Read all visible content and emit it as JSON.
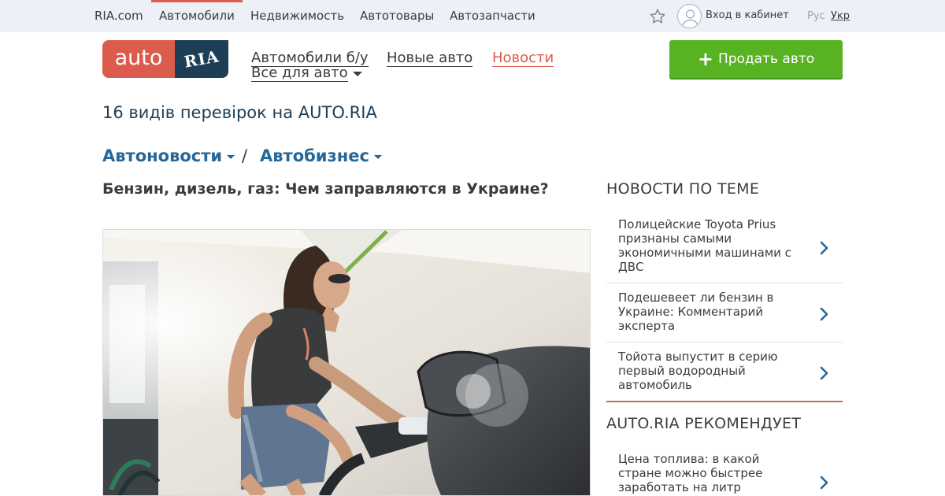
{
  "topbar": {
    "links": [
      "RIA.com",
      "Автомобили",
      "Недвижимость",
      "Автотовары",
      "Автозапчасти"
    ],
    "active": "Автомобили",
    "login_label": "Вход в кабинет",
    "lang_ru": "Рус",
    "lang_ua": "Укр"
  },
  "logo": {
    "auto": "auto",
    "ria": "RIA"
  },
  "header_nav": {
    "used_cars": "Автомобили б/у",
    "new_cars": "Новые авто",
    "news": "Новости",
    "all_for_car": "Все для авто"
  },
  "sell_button": "Продать авто",
  "promo": "16 видів перевірок на AUTO.RIA",
  "breadcrumb": {
    "item1": "Автоновости",
    "separator": "/",
    "item2": "Автобизнес"
  },
  "article": {
    "title": "Бензин, дизель, газ: Чем заправляются в Украине?"
  },
  "sidebar": {
    "related_title": "НОВОСТИ ПО ТЕМЕ",
    "related": [
      "Полицейские Toyota Prius признаны самыми экономичными машинами с ДВС",
      "Подешевеет ли бензин в Украине: Комментарий эксперта",
      "Тойота выпустит в серию первый водородный автомобиль"
    ],
    "recommend_title": "AUTO.RIA РЕКОМЕНДУЕТ",
    "recommend": [
      "Цена топлива: в какой стране можно быстрее заработать на литр"
    ]
  },
  "colors": {
    "brand_red": "#db5c4c",
    "brand_navy": "#1d3e57",
    "link_blue": "#256799",
    "sell_green": "#57b321",
    "topbar_bg": "#edf0f7"
  }
}
